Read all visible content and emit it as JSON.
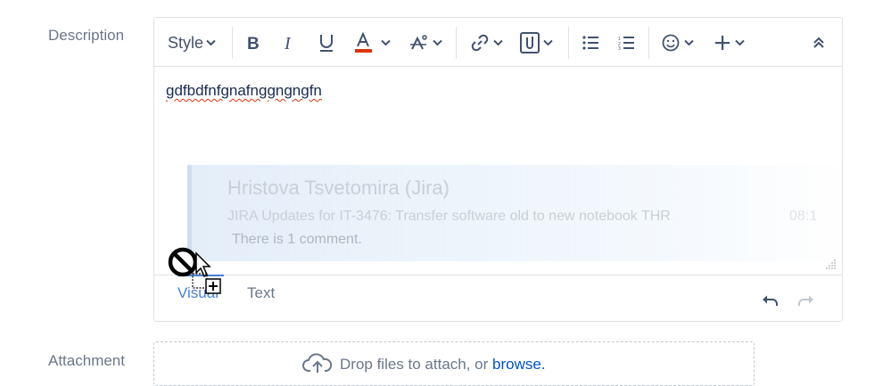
{
  "description": {
    "label": "Description",
    "content_text": "gdfbdfnfgnafnggngngfn"
  },
  "toolbar": {
    "style_label": "Style",
    "icons": [
      "bold-icon",
      "italic-icon",
      "underline-icon",
      "text-color-icon",
      "text-effects-icon",
      "link-icon",
      "attachment-icon",
      "bullet-list-icon",
      "numbered-list-icon",
      "emoji-icon",
      "plus-icon",
      "collapse-icon"
    ],
    "text_color_accent": "#de350b"
  },
  "notification": {
    "sender": "Hristova Tsvetomira (Jira)",
    "subject": "JIRA Updates for IT-3476: Transfer software old to new notebook THR",
    "time": "08:1",
    "body": "There is 1 comment."
  },
  "modes": {
    "visual": "Visual",
    "text": "Text",
    "active": "visual",
    "active_color": "#4c7fd0"
  },
  "attachment": {
    "label": "Attachment",
    "drop_text": "Drop files to attach, or ",
    "browse_link": "browse."
  }
}
